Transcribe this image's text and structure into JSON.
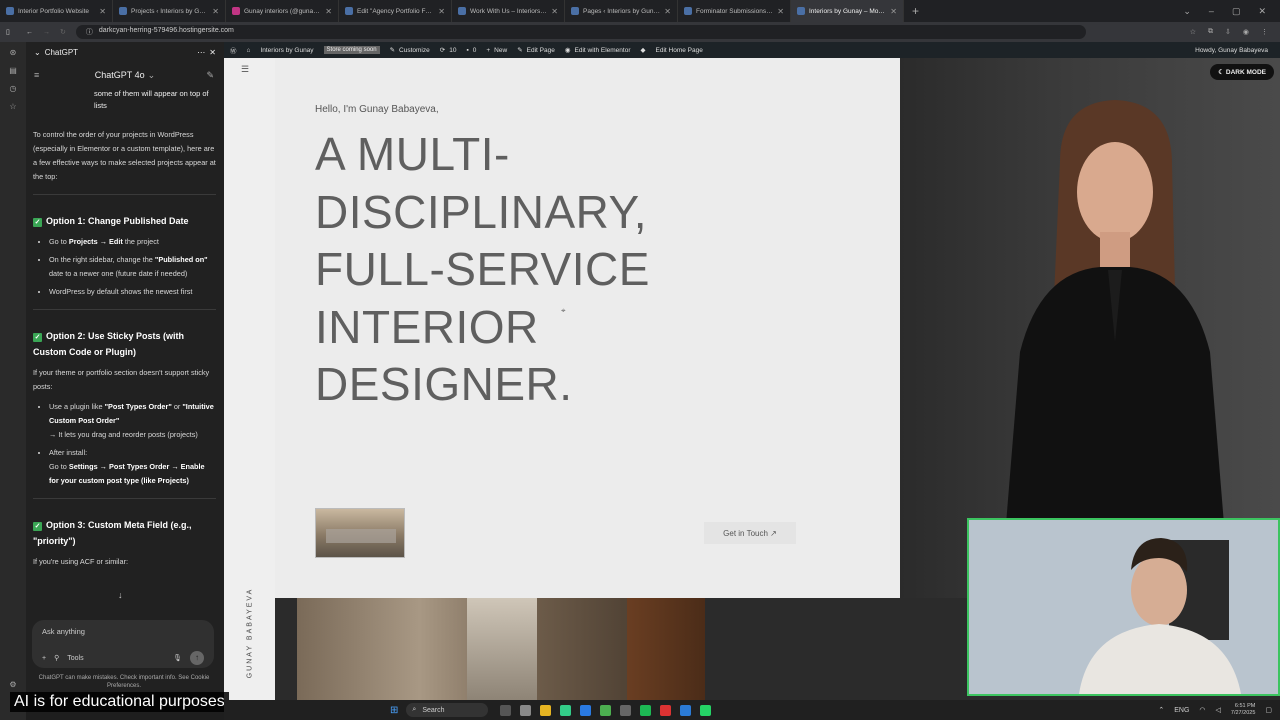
{
  "browser": {
    "tabs": [
      {
        "title": "Interior Portfolio Website",
        "active": false
      },
      {
        "title": "Projects ‹ Interiors by Gunay —",
        "active": false
      },
      {
        "title": "Gunay interiors (@gunay.interi",
        "active": false
      },
      {
        "title": "Edit \"Agency Portfolio Footer\"",
        "active": false
      },
      {
        "title": "Work With Us – Interiors by Gu",
        "active": false
      },
      {
        "title": "Pages ‹ Interiors by Gunay — W",
        "active": false
      },
      {
        "title": "Forminator Submissions ‹ Inter",
        "active": false
      },
      {
        "title": "Interiors by Gunay – Modern In",
        "active": true
      }
    ],
    "new_tab": "+",
    "url": "darkcyan-herring-579496.hostingersite.com"
  },
  "sidebar": {
    "header_title": "ChatGPT",
    "model_label": "ChatGPT 4o",
    "user_bubble": "some of them will appear on top of lists",
    "intro": "To control the order of your projects in WordPress (especially in Elementor or a custom template), here are a few effective ways to make selected projects appear at the top:",
    "option1": {
      "title": "Option 1: Change Published Date",
      "items": [
        {
          "pre": "Go to ",
          "bold": "Projects → Edit",
          "post": " the project"
        },
        {
          "pre": "On the right sidebar, change the ",
          "bold": "\"Published on\"",
          "post": " date to a newer one (future date if needed)"
        },
        {
          "pre": "WordPress by default shows the newest first",
          "bold": "",
          "post": ""
        }
      ]
    },
    "option2": {
      "title": "Option 2: Use Sticky Posts (with Custom Code or Plugin)",
      "desc": "If your theme or portfolio section doesn't support sticky posts:",
      "item1_pre": "Use a plugin like ",
      "item1_b1": "\"Post Types Order\"",
      "item1_mid": " or ",
      "item1_b2": "\"Intuitive Custom Post Order\"",
      "item1_post": "→ It lets you drag and reorder posts (projects)",
      "item2_pre": "After install:",
      "item2_text_pre": "Go to ",
      "item2_b": "Settings → Post Types Order → Enable for your custom post type (like Projects)"
    },
    "option3": {
      "title": "Option 3: Custom Meta Field (e.g., \"priority\")",
      "desc": "If you're using ACF or similar:"
    },
    "composer_placeholder": "Ask anything",
    "tools_label": "Tools",
    "disclaimer": "ChatGPT can make mistakes. Check important info. See Cookie Preferences."
  },
  "wp_admin_bar": {
    "site_name": "Interiors by Gunay",
    "badge": "Store coming soon",
    "customize": "Customize",
    "updates": "10",
    "comments": "0",
    "new": "New",
    "edit_page": "Edit Page",
    "edit_elementor": "Edit with Elementor",
    "edit_home": "Edit Home Page",
    "howdy": "Howdy, Gunay Babayeva"
  },
  "site": {
    "vertical_name": "GUNAY  BABAYEVA",
    "greeting": "Hello, I'm Gunay Babayeva,",
    "headline_lines": [
      "A MULTI-",
      "DISCIPLINARY,",
      "FULL-SERVICE",
      "INTERIOR",
      "DESIGNER."
    ],
    "cta": "Get in Touch ↗",
    "dark_mode": "DARK MODE"
  },
  "caption": "AI is for educational purposes",
  "taskbar": {
    "search": "Search",
    "lang": "ENG",
    "time": "6:51 PM",
    "date": "7/27/2025"
  },
  "colors": {
    "accent_green": "#3aa655",
    "cam_border": "#3cc460",
    "wp_bar": "#1d2327"
  }
}
